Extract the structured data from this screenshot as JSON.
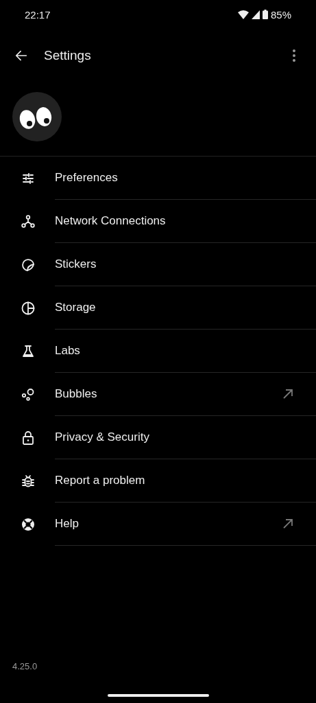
{
  "status_bar": {
    "time": "22:17",
    "battery": "85%"
  },
  "app_bar": {
    "title": "Settings"
  },
  "items": [
    {
      "label": "Preferences",
      "external": false
    },
    {
      "label": "Network Connections",
      "external": false
    },
    {
      "label": "Stickers",
      "external": false
    },
    {
      "label": "Storage",
      "external": false
    },
    {
      "label": "Labs",
      "external": false
    },
    {
      "label": "Bubbles",
      "external": true
    },
    {
      "label": "Privacy & Security",
      "external": false
    },
    {
      "label": "Report a problem",
      "external": false
    },
    {
      "label": "Help",
      "external": true
    }
  ],
  "version": "4.25.0"
}
